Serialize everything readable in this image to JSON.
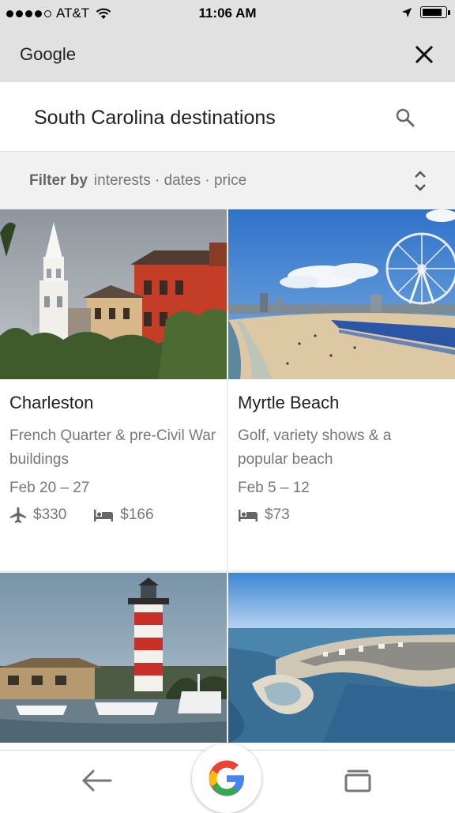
{
  "status_bar": {
    "carrier": "AT&T",
    "time": "11:06 AM",
    "battery_level": 0.9
  },
  "header": {
    "title": "Google",
    "close_icon": "close-icon"
  },
  "search": {
    "query": "South Carolina destinations",
    "icon": "search-icon"
  },
  "filter": {
    "label": "Filter by",
    "options": "interests · dates · price",
    "toggle_icon": "unfold-icon"
  },
  "destinations": [
    {
      "name": "Charleston",
      "description": "French Quarter & pre-Civil War buildings",
      "dates": "Feb 20 – 27",
      "flight_price": "$330",
      "hotel_price": "$166"
    },
    {
      "name": "Myrtle Beach",
      "description": "Golf, variety shows & a popular beach",
      "dates": "Feb 5 – 12",
      "hotel_price": "$73"
    }
  ],
  "bottom_nav": {
    "back_icon": "back-arrow-icon",
    "home_icon": "google-logo-icon",
    "tabs_icon": "tabs-icon"
  },
  "colors": {
    "chrome_gray": "#e1e1e1",
    "filter_bg": "#f1f1f1",
    "text_primary": "#212121",
    "text_secondary": "#777777",
    "google_blue": "#4285F4",
    "google_red": "#EA4335",
    "google_yellow": "#FBBC05",
    "google_green": "#34A853"
  }
}
